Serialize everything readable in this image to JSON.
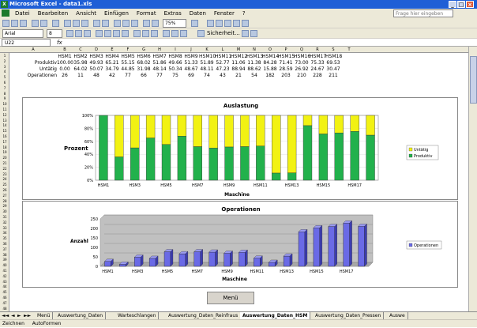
{
  "window": {
    "title": "Microsoft Excel - data1.xls"
  },
  "menu": {
    "items": [
      "Datei",
      "Bearbeiten",
      "Ansicht",
      "Einfügen",
      "Format",
      "Extras",
      "Daten",
      "Fenster",
      "?"
    ],
    "help_placeholder": "Frage hier eingeben"
  },
  "toolbar": {
    "font": "Arial",
    "size": "8",
    "zoom": "75%",
    "security": "Sicherheit..."
  },
  "formula": {
    "cell": "U22",
    "fx": "fx"
  },
  "columns": [
    "A",
    "B",
    "C",
    "D",
    "E",
    "F",
    "G",
    "H",
    "I",
    "J",
    "K",
    "L",
    "M",
    "N",
    "O",
    "P",
    "Q",
    "R",
    "S",
    "T"
  ],
  "table": {
    "headers": [
      "HSM1",
      "HSM2",
      "HSM3",
      "HSM4",
      "HSM5",
      "HSM6",
      "HSM7",
      "HSM8",
      "HSM9",
      "HSM10",
      "HSM11",
      "HSM12",
      "HSM13",
      "HSM14",
      "HSM15",
      "HSM16",
      "HSM17",
      "HSM18"
    ],
    "rows": [
      {
        "label": "Produktiv",
        "values": [
          "100.00",
          "35.98",
          "49.93",
          "65.21",
          "55.15",
          "68.02",
          "51.86",
          "49.66",
          "51.33",
          "51.89",
          "52.77",
          "11.06",
          "11.38",
          "84.28",
          "71.41",
          "73.00",
          "75.33",
          "69.53"
        ]
      },
      {
        "label": "Untätig",
        "values": [
          "0.00",
          "64.02",
          "50.07",
          "34.79",
          "44.85",
          "31.98",
          "48.14",
          "50.34",
          "48.67",
          "48.11",
          "47.23",
          "88.94",
          "88.62",
          "15.88",
          "28.59",
          "26.92",
          "24.67",
          "30.47"
        ]
      },
      {
        "label": "Operationen",
        "values": [
          "26",
          "11",
          "48",
          "42",
          "77",
          "66",
          "77",
          "75",
          "69",
          "74",
          "43",
          "21",
          "54",
          "182",
          "203",
          "210",
          "228",
          "211"
        ]
      }
    ]
  },
  "chart_data": [
    {
      "type": "bar",
      "stacked": "percent",
      "title": "Auslastung",
      "xlabel": "Maschine",
      "ylabel": "Prozent",
      "categories": [
        "HSM1",
        "HSM2",
        "HSM3",
        "HSM4",
        "HSM5",
        "HSM6",
        "HSM7",
        "HSM8",
        "HSM9",
        "HSM10",
        "HSM11",
        "HSM12",
        "HSM13",
        "HSM14",
        "HSM15",
        "HSM16",
        "HSM17",
        "HSM18"
      ],
      "xtick_labels": [
        "HSM1",
        "",
        "HSM3",
        "",
        "HSM5",
        "",
        "HSM7",
        "",
        "HSM9",
        "",
        "HSM11",
        "",
        "HSM13",
        "",
        "HSM15",
        "",
        "HSM17",
        ""
      ],
      "yticks": [
        "0%",
        "20%",
        "40%",
        "60%",
        "80%",
        "100%"
      ],
      "ylim": [
        0,
        100
      ],
      "series": [
        {
          "name": "Produktiv",
          "color": "#22b14c",
          "values": [
            100,
            35.98,
            49.93,
            65.21,
            55.15,
            68.02,
            51.86,
            49.66,
            51.33,
            51.89,
            52.77,
            11.06,
            11.38,
            84.28,
            71.41,
            73,
            75.33,
            69.53
          ]
        },
        {
          "name": "Untätig",
          "color": "#f2f213",
          "values": [
            0,
            64.02,
            50.07,
            34.79,
            44.85,
            31.98,
            48.14,
            50.34,
            48.67,
            48.11,
            47.23,
            88.94,
            88.62,
            15.88,
            28.59,
            26.92,
            24.67,
            30.47
          ]
        }
      ],
      "legend": "right"
    },
    {
      "type": "bar",
      "title": "Operationen",
      "xlabel": "Maschine",
      "ylabel": "Anzahl",
      "categories": [
        "HSM1",
        "HSM2",
        "HSM3",
        "HSM4",
        "HSM5",
        "HSM6",
        "HSM7",
        "HSM8",
        "HSM9",
        "HSM10",
        "HSM11",
        "HSM12",
        "HSM13",
        "HSM14",
        "HSM15",
        "HSM16",
        "HSM17",
        "HSM18"
      ],
      "xtick_labels": [
        "HSM1",
        "",
        "HSM3",
        "",
        "HSM5",
        "",
        "HSM7",
        "",
        "HSM9",
        "",
        "HSM11",
        "",
        "HSM13",
        "",
        "HSM15",
        "",
        "HSM17",
        ""
      ],
      "yticks": [
        "0",
        "50",
        "100",
        "150",
        "200",
        "250"
      ],
      "ylim": [
        0,
        250
      ],
      "series": [
        {
          "name": "Operationen",
          "color": "#6a6ae6",
          "values": [
            26,
            11,
            48,
            42,
            77,
            66,
            77,
            75,
            69,
            74,
            43,
            21,
            54,
            182,
            203,
            210,
            228,
            211
          ]
        }
      ],
      "legend": "right"
    }
  ],
  "button": {
    "menu": "Menü"
  },
  "sheets": [
    "Menü",
    "Auswertung_Daten",
    "Warteschlangen",
    "Auswertung_Daten_Reinfraus",
    "Auswertung_Daten_HSM",
    "Auswertung_Daten_Pressen",
    "Auswe"
  ],
  "active_sheet": "Auswertung_Daten_HSM",
  "status": {
    "draw": "Zeichnen",
    "autoshapes": "AutoFormen"
  }
}
